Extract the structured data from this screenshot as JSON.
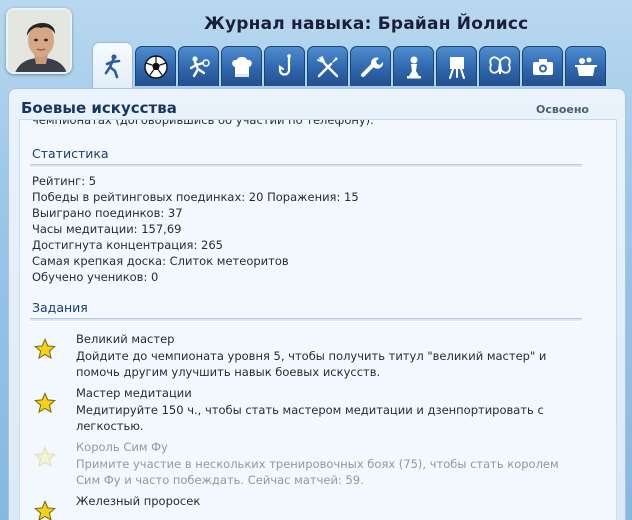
{
  "header": {
    "title": "Журнал навыка: Брайан Йолисс"
  },
  "tabs": [
    {
      "icon": "martial-arts-icon",
      "active": true
    },
    {
      "icon": "soccer-ball-icon"
    },
    {
      "icon": "athletic-icon"
    },
    {
      "icon": "chef-hat-icon"
    },
    {
      "icon": "fishing-hook-icon"
    },
    {
      "icon": "gardening-tools-icon"
    },
    {
      "icon": "wrench-icon"
    },
    {
      "icon": "chess-pawn-icon"
    },
    {
      "icon": "easel-icon"
    },
    {
      "icon": "butterfly-icon"
    },
    {
      "icon": "camera-icon"
    },
    {
      "icon": "cooking-pot-icon"
    }
  ],
  "skill": {
    "name": "Боевые искусства",
    "status": "Освоено"
  },
  "scroll_fragment": "чемпионатах (договорившись об участии по телефону).",
  "statistics": {
    "title": "Статистика",
    "lines": [
      "Рейтинг: 5",
      "Победы в рейтинговых поединках: 20 Поражения: 15",
      "Выиграно поединков: 37",
      "Часы медитации: 157,69",
      "Достигнута концентрация: 265",
      "Самая крепкая доска: Слиток метеоритов",
      "Обучено учеников: 0"
    ]
  },
  "tasks": {
    "title": "Задания",
    "items": [
      {
        "name": "Великий мастер",
        "description": "Дойдите до чемпионата уровня 5, чтобы получить титул \"великий мастер\" и помочь другим улучшить навык боевых искусств.",
        "completed": true
      },
      {
        "name": "Мастер медитации",
        "description": "Медитируйте 150 ч., чтобы стать мастером медитации и дзенпортировать с легкостью.",
        "completed": true
      },
      {
        "name": "Король Сим Фу",
        "description": "Примите участие в нескольких тренировочных боях (75), чтобы стать королем Сим Фу и часто побеждать. Сейчас матчей: 59.",
        "completed": false
      },
      {
        "name": "Железный проросек",
        "description": "",
        "completed": true
      }
    ]
  },
  "colors": {
    "star_gold": "#f2d21a",
    "tab_blue": "#2f67ad",
    "heading_blue": "#17365f"
  }
}
